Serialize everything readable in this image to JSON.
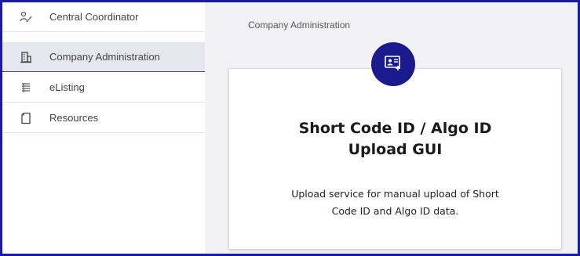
{
  "sidebar": {
    "items": [
      {
        "label": "Central Coordinator",
        "icon": "pen-person-icon",
        "active": false
      },
      {
        "label": "Company Administration",
        "icon": "building-icon",
        "active": true
      },
      {
        "label": "eListing",
        "icon": "list-icon",
        "active": false
      },
      {
        "label": "Resources",
        "icon": "document-icon",
        "active": false
      }
    ]
  },
  "main": {
    "breadcrumb": "Company Administration",
    "card": {
      "icon": "id-card-icon",
      "title_line1": "Short Code ID / Algo ID",
      "title_line2": "Upload GUI",
      "desc_line1": "Upload service for manual upload of Short",
      "desc_line2": "Code ID and Algo ID data."
    }
  },
  "colors": {
    "frame_border": "#1a1aa8",
    "badge": "#1a1a8c",
    "active_item_bg": "#e6e6ee",
    "main_bg": "#f2f2f4"
  }
}
